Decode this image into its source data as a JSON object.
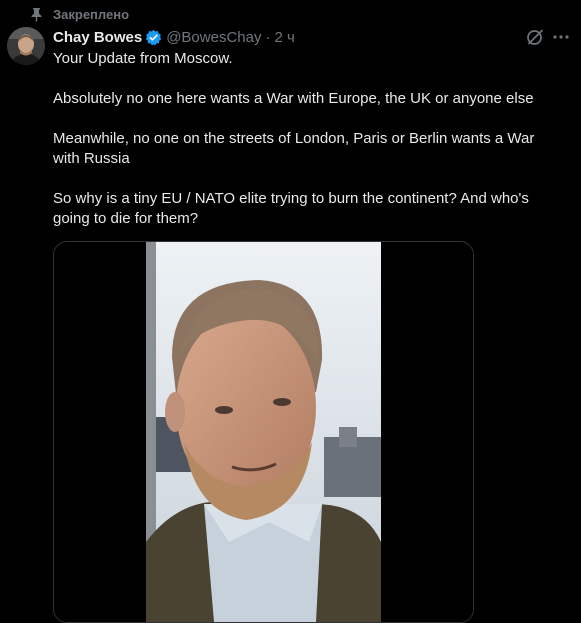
{
  "pinned": {
    "label": "Закреплено",
    "icon": "pin-icon"
  },
  "author": {
    "display_name": "Chay Bowes",
    "handle": "@BowesChay",
    "separator": "·",
    "time": "2 ч",
    "verified_color": "#1d9bf0"
  },
  "tweet": {
    "paragraphs": [
      "Your Update from Moscow.",
      "Absolutely no one here wants a War with Europe, the UK or anyone else",
      "Meanwhile, no one on the streets of London, Paris or Berlin wants a War with Russia",
      "So why is a tiny EU / NATO elite trying to burn the continent? And who's going to die for them?"
    ]
  },
  "actions": {
    "grok_icon": "grok-icon",
    "more_icon": "more-icon"
  },
  "media": {
    "type": "video"
  },
  "colors": {
    "background": "#000000",
    "text": "#e7e9ea",
    "muted": "#71767b",
    "border": "#2f3336"
  }
}
